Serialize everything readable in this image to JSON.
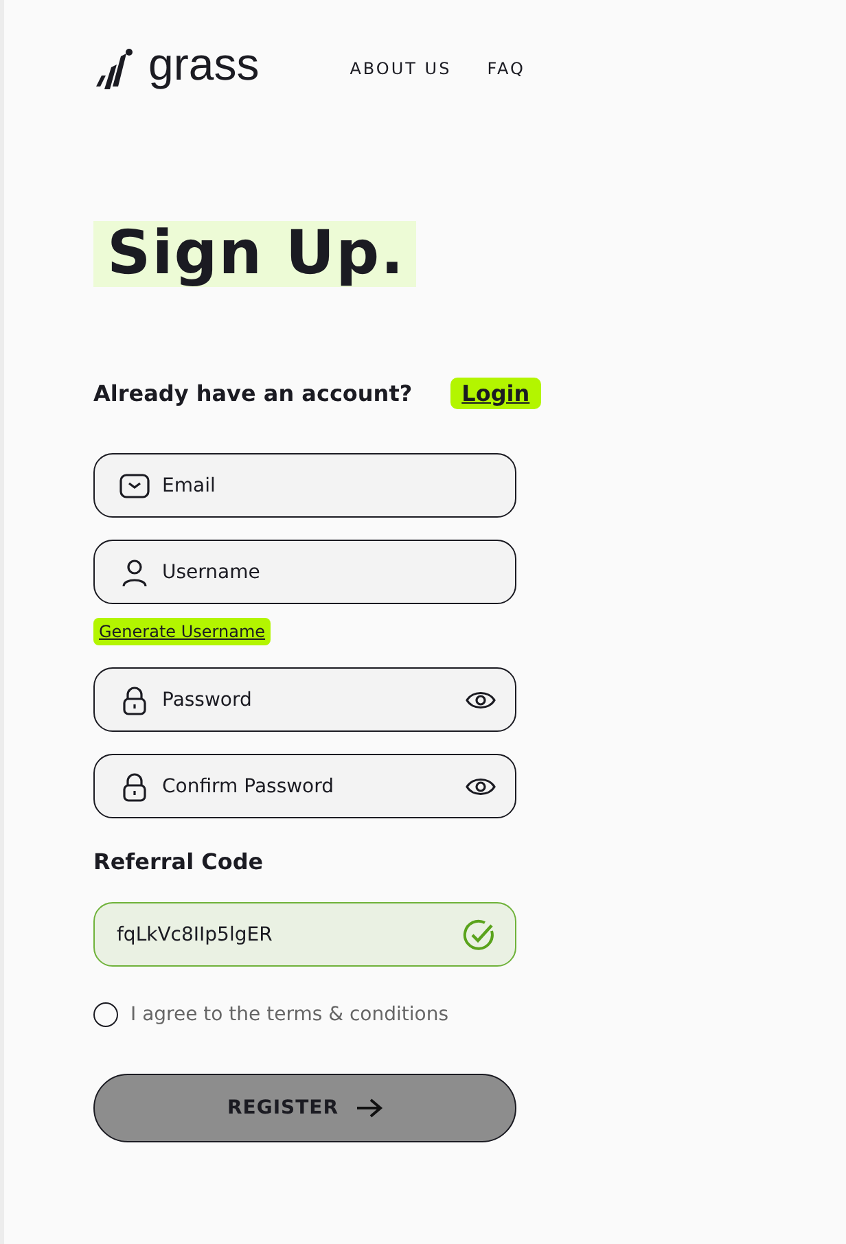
{
  "header": {
    "logo": "grass",
    "nav": [
      "ABOUT US",
      "FAQ"
    ]
  },
  "title": "Sign Up.",
  "login_prompt": {
    "text": "Already have an account?",
    "link": "Login"
  },
  "fields": [
    {
      "kind": "email",
      "placeholder": "Email"
    },
    {
      "kind": "username",
      "placeholder": "Username"
    },
    {
      "kind": "generate",
      "label": "Generate Username"
    },
    {
      "kind": "password",
      "placeholder": "Password"
    },
    {
      "kind": "password",
      "placeholder": "Confirm Password"
    }
  ],
  "referral": {
    "label": "Referral Code",
    "value": "fqLkVc8IIp5lgER",
    "valid": true
  },
  "terms": {
    "label": "I agree to the terms & conditions",
    "checked": false
  },
  "register": {
    "label": "REGISTER",
    "disabled": true
  }
}
